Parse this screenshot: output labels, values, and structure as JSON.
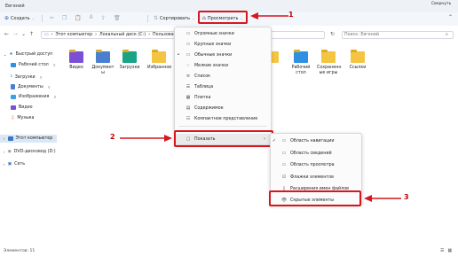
{
  "window": {
    "title": "Евгений"
  },
  "toolbar": {
    "create_label": "Создать",
    "sort_label": "Сортировать",
    "view_label": "Просмотреть",
    "more": "...",
    "tooltip": "Свернуть"
  },
  "address": {
    "crumbs": [
      "Этот компьютер",
      "Локальный диск (C:)",
      "Пользоват"
    ],
    "search_placeholder": "Поиск: Евгений"
  },
  "sidebar": {
    "items": [
      {
        "label": "Быстрый доступ",
        "icon": "star-icon"
      },
      {
        "label": "Рабочий стол",
        "icon": "desktop-icon",
        "pinned": true
      },
      {
        "label": "Загрузки",
        "icon": "download-icon",
        "pinned": true
      },
      {
        "label": "Документы",
        "icon": "documents-icon",
        "pinned": true
      },
      {
        "label": "Изображения",
        "icon": "pictures-icon",
        "pinned": true
      },
      {
        "label": "Видео",
        "icon": "video-icon"
      },
      {
        "label": "Музыка",
        "icon": "music-icon"
      },
      {
        "label": "Этот компьютер",
        "icon": "computer-icon",
        "selected": true
      },
      {
        "label": "DVD-дисковод (D:)",
        "icon": "dvd-icon"
      },
      {
        "label": "Сеть",
        "icon": "network-icon"
      }
    ]
  },
  "files": [
    {
      "label": "Видео",
      "color": "#7b4fd6"
    },
    {
      "label": "Документ ы",
      "color": "#4a7fd0"
    },
    {
      "label": "Загрузки",
      "color": "#1aa384"
    },
    {
      "label": "Избранное",
      "color": "#f4c542"
    },
    {
      "label": "Рабочий стол",
      "color": "#2f8fe0"
    },
    {
      "label": "Сохраненн ые игры",
      "color": "#f4c542"
    },
    {
      "label": "Ссылки",
      "color": "#f4c542"
    }
  ],
  "view_menu": {
    "items": [
      {
        "label": "Огромные значки",
        "icon": "monitor-icon"
      },
      {
        "label": "Крупные значки",
        "icon": "monitor-icon"
      },
      {
        "label": "Обычные значки",
        "icon": "monitor-icon",
        "checked": true
      },
      {
        "label": "Мелкие значки",
        "icon": "grid-icon"
      },
      {
        "label": "Список",
        "icon": "list-icon"
      },
      {
        "label": "Таблица",
        "icon": "table-icon"
      },
      {
        "label": "Плитка",
        "icon": "tiles-icon"
      },
      {
        "label": "Содержимое",
        "icon": "content-icon"
      },
      {
        "label": "Компактное представление",
        "icon": "compact-icon"
      },
      {
        "label": "Показать",
        "icon": "show-icon",
        "submenu": true
      }
    ]
  },
  "show_submenu": {
    "items": [
      {
        "label": "Область навигации",
        "icon": "navpane-icon",
        "checked": true
      },
      {
        "label": "Область сведений",
        "icon": "details-icon"
      },
      {
        "label": "Область просмотра",
        "icon": "preview-icon"
      },
      {
        "label": "Флажки элементов",
        "icon": "checkbox-icon"
      },
      {
        "label": "Расширения имен файлов",
        "icon": "file-ext-icon"
      },
      {
        "label": "Скрытые элементы",
        "icon": "eye-icon"
      }
    ]
  },
  "annotations": {
    "arrow1": "1",
    "arrow2": "2",
    "arrow3": "3"
  },
  "colors": {
    "annotation_red": "#d6171f",
    "selection": "#dbe7f5",
    "folder": "#f4c542"
  },
  "statusbar": {
    "text": "Элементов: 11"
  }
}
